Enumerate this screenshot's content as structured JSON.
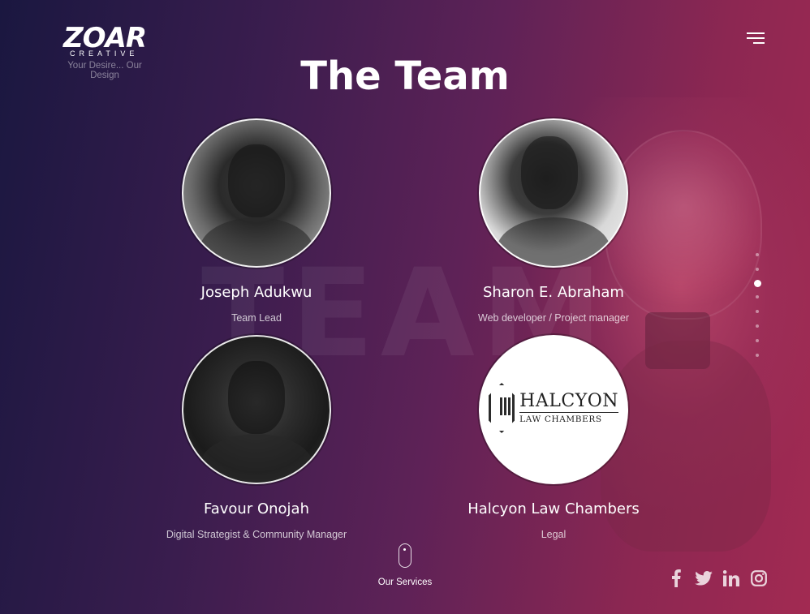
{
  "brand": {
    "name": "ZOAR",
    "sub": "CREATIVE",
    "tagline": "Your Desire... Our Design"
  },
  "background": {
    "watermark": "TEAM"
  },
  "section": {
    "title": "The Team"
  },
  "team": [
    {
      "name": "Joseph Adukwu",
      "role": "Team Lead",
      "photo": "portrait"
    },
    {
      "name": "Sharon E. Abraham",
      "role": "Web developer / Project manager",
      "photo": "portrait"
    },
    {
      "name": "Favour Onojah",
      "role": "Digital Strategist & Community Manager",
      "photo": "portrait"
    },
    {
      "name": "Halcyon Law Chambers",
      "role": "Legal",
      "photo": "logo",
      "logo_text": {
        "name": "HALCYON",
        "sub": "LAW CHAMBERS"
      }
    }
  ],
  "nav_dots": {
    "count": 8,
    "active_index": 2
  },
  "scroll_hint": {
    "label": "Our Services",
    "icon": "mouse-scroll-icon"
  },
  "social": [
    {
      "name": "facebook",
      "icon": "facebook-icon"
    },
    {
      "name": "twitter",
      "icon": "twitter-icon"
    },
    {
      "name": "linkedin",
      "icon": "linkedin-icon"
    },
    {
      "name": "instagram",
      "icon": "instagram-icon"
    }
  ],
  "menu": {
    "icon": "hamburger-menu-icon"
  },
  "colors": {
    "gradient_start": "#1a1740",
    "gradient_end": "#a22a52",
    "text": "#ffffff"
  }
}
